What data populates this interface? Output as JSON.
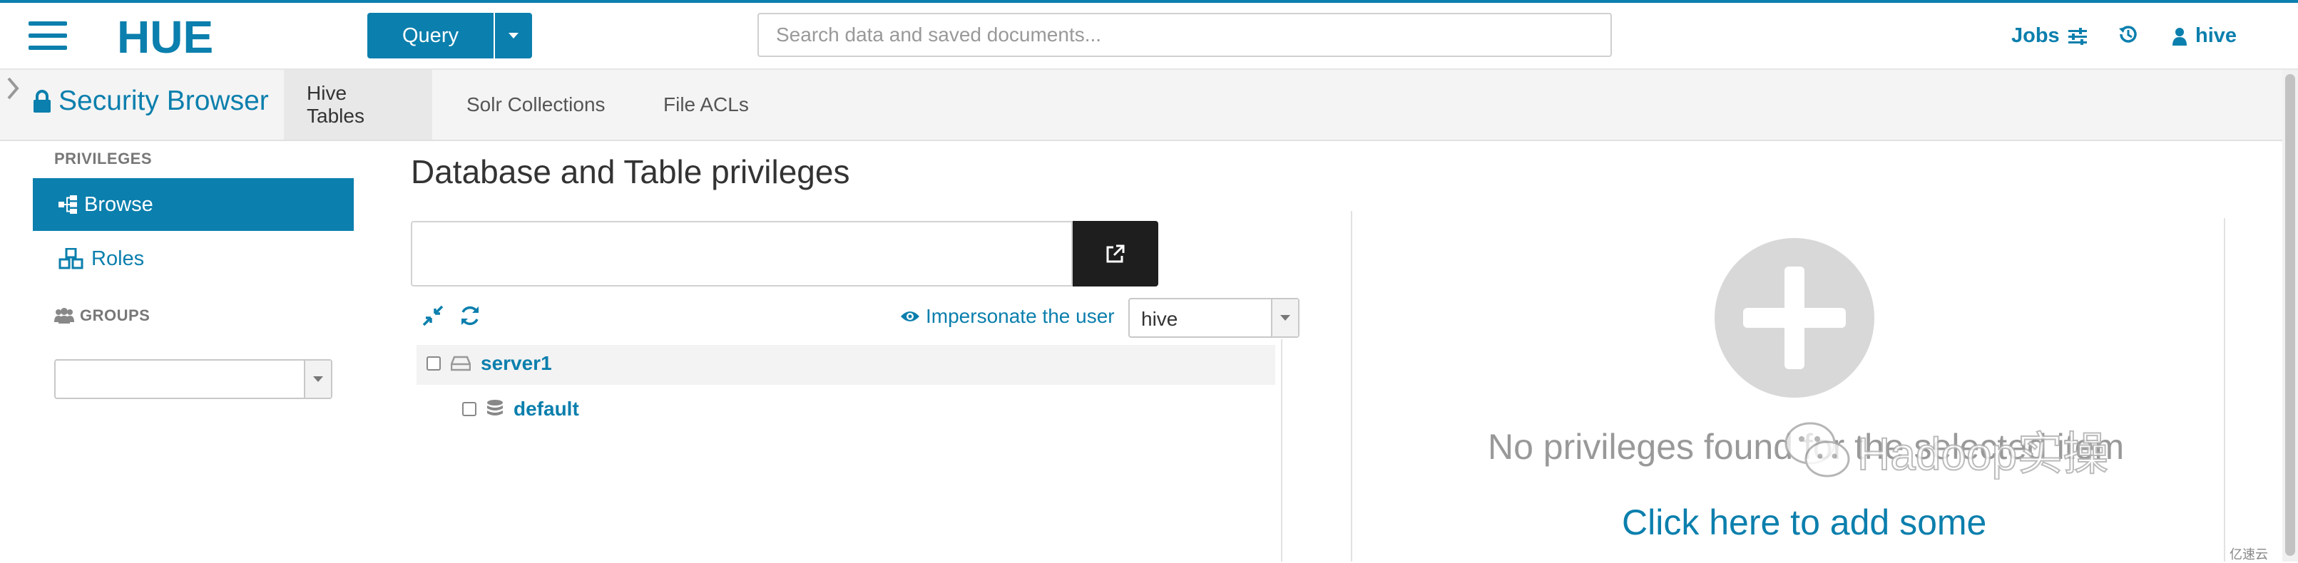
{
  "navbar": {
    "logo_text": "HUE",
    "query_label": "Query",
    "search_placeholder": "Search data and saved documents...",
    "jobs_label": "Jobs",
    "user_label": "hive"
  },
  "subheader": {
    "title": "Security Browser",
    "tabs": [
      {
        "label": "Hive Tables",
        "active": true
      },
      {
        "label": "Solr Collections",
        "active": false
      },
      {
        "label": "File ACLs",
        "active": false
      }
    ]
  },
  "sidebar": {
    "privileges_heading": "PRIVILEGES",
    "items": [
      {
        "label": "Browse",
        "active": true
      },
      {
        "label": "Roles",
        "active": false
      }
    ],
    "groups_heading": "GROUPS",
    "groups_selected": ""
  },
  "main": {
    "title": "Database and Table privileges",
    "path_value": "",
    "impersonate_label": "Impersonate the user",
    "impersonate_user": "hive",
    "tree": [
      {
        "label": "server1",
        "icon": "server-icon",
        "level": 0
      },
      {
        "label": "default",
        "icon": "database-icon",
        "level": 1
      }
    ]
  },
  "right_panel": {
    "empty_message": "No privileges found for the selected item",
    "add_link": "Click here to add some"
  },
  "watermark": {
    "text": "Hadoop实操",
    "small_text": "亿速云"
  },
  "colors": {
    "accent": "#0B7FAD",
    "dark_button": "#1e1e1e"
  }
}
